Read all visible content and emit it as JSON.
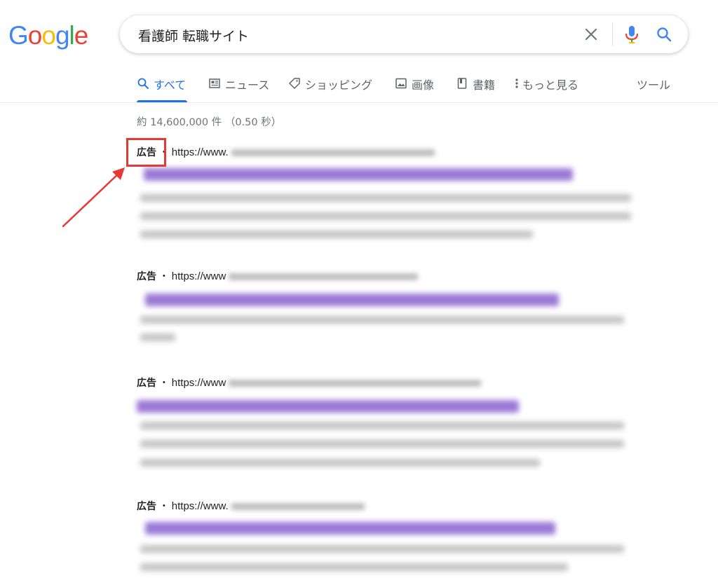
{
  "logo": {
    "letters": [
      "G",
      "o",
      "o",
      "g",
      "l",
      "e"
    ],
    "colors": [
      "#4285F4",
      "#EA4335",
      "#FBBC05",
      "#4285F4",
      "#34A853",
      "#EA4335"
    ]
  },
  "search": {
    "query": "看護師 転職サイト"
  },
  "icons": {
    "clear": "close-icon",
    "mic": "microphone-icon",
    "search": "search-icon"
  },
  "tabs": [
    {
      "label": "すべて",
      "icon": "search-icon",
      "active": true
    },
    {
      "label": "ニュース",
      "icon": "news-icon"
    },
    {
      "label": "ショッピング",
      "icon": "tag-icon"
    },
    {
      "label": "画像",
      "icon": "image-icon"
    },
    {
      "label": "書籍",
      "icon": "book-icon"
    },
    {
      "label": "もっと見る",
      "icon": "more-vert-icon"
    }
  ],
  "tools_label": "ツール",
  "stats": "約 14,600,000 件 （0.50 秒）",
  "ads": [
    {
      "label": "広告",
      "separator": "・",
      "url": "https://www."
    },
    {
      "label": "広告",
      "separator": "・",
      "url": "https://www"
    },
    {
      "label": "広告",
      "separator": "・",
      "url": "https://www"
    },
    {
      "label": "広告",
      "separator": "・",
      "url": "https://www."
    }
  ],
  "colors": {
    "accent": "#1a73e8",
    "annotation": "#e53935",
    "ad_title": "#9b79d6"
  }
}
